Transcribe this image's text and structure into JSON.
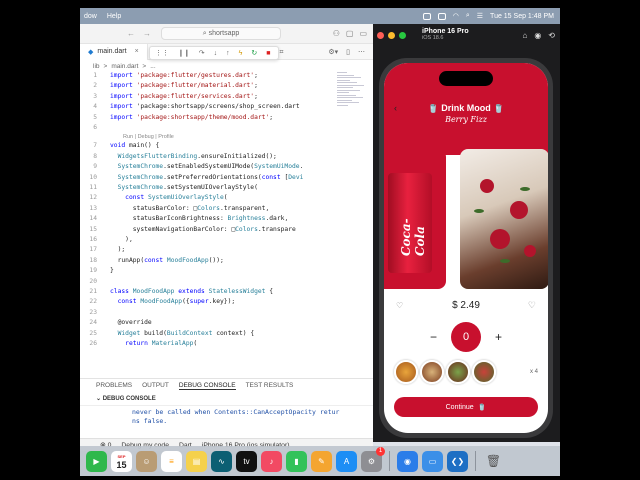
{
  "menubar": {
    "left_items": [
      "dow",
      "Help"
    ],
    "date_time": "Tue 15 Sep  1:48 PM"
  },
  "vscode": {
    "search_text": "shortsapp",
    "tab_label": "main.dart",
    "breadcrumb": [
      "lib",
      ">",
      "main.dart",
      ">",
      "..."
    ],
    "codelens": "Run | Debug | Profile",
    "lines": [
      {
        "n": "1",
        "t": "import 'package:flutter/gestures.dart';"
      },
      {
        "n": "2",
        "t": "import 'package:flutter/material.dart';"
      },
      {
        "n": "3",
        "t": "import 'package:flutter/services.dart';"
      },
      {
        "n": "4",
        "t": "import 'package:shortsapp/screens/shop_screen.dart"
      },
      {
        "n": "5",
        "t": "import 'package:shortsapp/theme/mood.dart';"
      },
      {
        "n": "6",
        "t": ""
      },
      {
        "n": "7",
        "t": "void main() {"
      },
      {
        "n": "8",
        "t": "  WidgetsFlutterBinding.ensureInitialized();"
      },
      {
        "n": "9",
        "t": "  SystemChrome.setEnabledSystemUIMode(SystemUiMode."
      },
      {
        "n": "10",
        "t": "  SystemChrome.setPreferredOrientations(const [Devi"
      },
      {
        "n": "11",
        "t": "  SystemChrome.setSystemUIOverlayStyle("
      },
      {
        "n": "12",
        "t": "    const SystemUiOverlayStyle("
      },
      {
        "n": "13",
        "t": "      statusBarColor: □Colors.transparent,"
      },
      {
        "n": "14",
        "t": "      statusBarIconBrightness: Brightness.dark,"
      },
      {
        "n": "15",
        "t": "      systemNavigationBarColor: □Colors.transpare"
      },
      {
        "n": "16",
        "t": "    ),"
      },
      {
        "n": "17",
        "t": "  );"
      },
      {
        "n": "18",
        "t": "  runApp(const MoodFoodApp());"
      },
      {
        "n": "19",
        "t": "}"
      },
      {
        "n": "20",
        "t": ""
      },
      {
        "n": "21",
        "t": "class MoodFoodApp extends StatelessWidget {"
      },
      {
        "n": "22",
        "t": "  const MoodFoodApp({super.key});"
      },
      {
        "n": "23",
        "t": ""
      },
      {
        "n": "24",
        "t": "  @override"
      },
      {
        "n": "25",
        "t": "  Widget build(BuildContext context) {"
      },
      {
        "n": "26",
        "t": "    return MaterialApp("
      }
    ],
    "panel_tabs": [
      "PROBLEMS",
      "OUTPUT",
      "DEBUG CONSOLE",
      "TEST RESULTS"
    ],
    "active_panel_tab": "DEBUG CONSOLE",
    "console_header": "DEBUG CONSOLE",
    "console_lines": [
      "never be called when Contents::CanAcceptOpacity retur",
      "ns false."
    ],
    "status": {
      "debug": "Debug my code",
      "lang": "Dart",
      "device": "iPhone 16 Pro (ios simulator)"
    }
  },
  "simulator": {
    "device_name": "iPhone 16 Pro",
    "os_version": "iOS 18.6",
    "app": {
      "title": "Drink Mood",
      "subtitle": "Berry Fizz",
      "card1_logo": "Coca-Cola",
      "price": "$ 2.49",
      "quantity": "0",
      "thumb_count": "x 4",
      "continue_label": "Continue",
      "accent_color": "#c8102e"
    }
  },
  "dock": {
    "calendar_day": "15",
    "badge": "1"
  }
}
